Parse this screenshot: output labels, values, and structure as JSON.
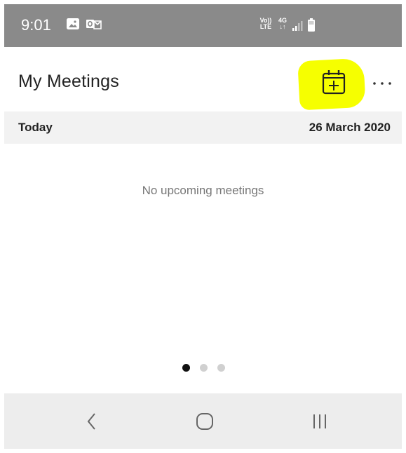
{
  "status_bar": {
    "time": "9:01",
    "icons": [
      "gallery-icon",
      "outlook-icon",
      "volte-icon",
      "4g-icon",
      "signal-icon",
      "battery-icon"
    ],
    "volte_top": "Vo))",
    "volte_bottom": "LTE",
    "network_top": "4G",
    "network_bottom": "↓↑"
  },
  "header": {
    "title": "My Meetings",
    "add_icon": "calendar-add-icon",
    "more_icon": "more-horizontal-icon",
    "highlight_color": "#f6ff00"
  },
  "date_section": {
    "label": "Today",
    "date": "26 March 2020"
  },
  "main": {
    "empty_message": "No upcoming meetings"
  },
  "pager": {
    "pages": 3,
    "current_page": 1
  },
  "nav_bar": {
    "icons": [
      "back-icon",
      "home-icon",
      "recents-icon"
    ]
  },
  "colors": {
    "status_bar": "#8a8a8a",
    "date_header": "#f2f2f2",
    "nav_bar": "#ededed"
  }
}
